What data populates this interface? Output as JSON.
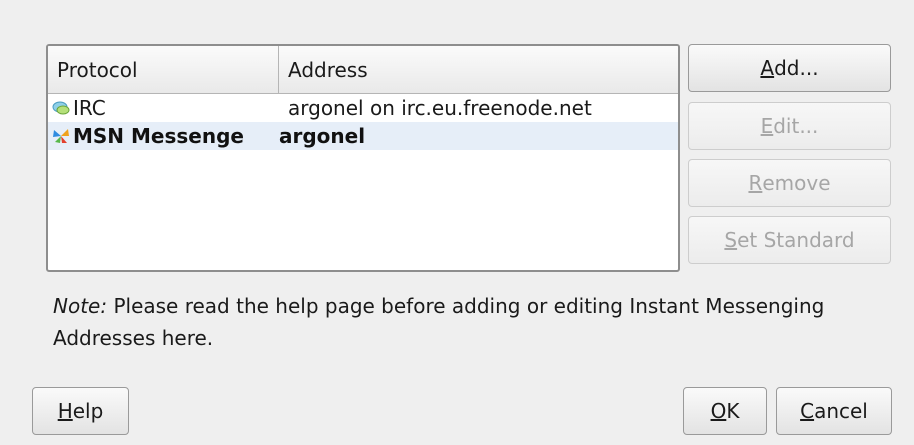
{
  "table": {
    "headers": {
      "protocol": "Protocol",
      "address": "Address"
    },
    "rows": [
      {
        "protocol": "IRC",
        "address": "argonel on irc.eu.freenode.net",
        "icon": "irc-icon",
        "selected": false
      },
      {
        "protocol": "MSN Messenge",
        "address": "argonel",
        "icon": "msn-butterfly-icon",
        "selected": true
      }
    ]
  },
  "buttons": {
    "add": {
      "pre": "",
      "mnemonic": "A",
      "post": "dd..."
    },
    "edit": {
      "pre": "",
      "mnemonic": "E",
      "post": "dit..."
    },
    "remove": {
      "pre": "",
      "mnemonic": "R",
      "post": "emove"
    },
    "set_standard": {
      "pre": "",
      "mnemonic": "S",
      "post": "et Standard"
    },
    "help": {
      "pre": "",
      "mnemonic": "H",
      "post": "elp"
    },
    "ok": {
      "pre": "",
      "mnemonic": "O",
      "post": "K"
    },
    "cancel": {
      "pre": "",
      "mnemonic": "C",
      "post": "ancel"
    }
  },
  "note": {
    "label": "Note:",
    "text": " Please read the help page before adding or editing Instant Messenging Addresses here."
  }
}
